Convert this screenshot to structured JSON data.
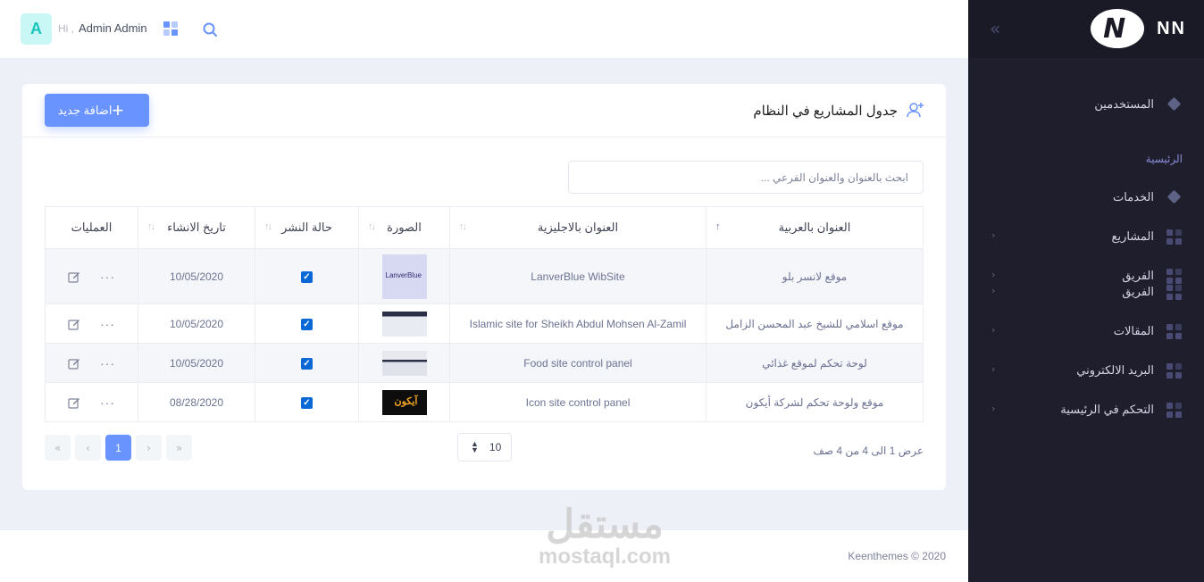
{
  "header": {
    "avatar_letter": "A",
    "greeting": "Hi ,",
    "user_name": "Admin Admin"
  },
  "sidebar": {
    "logo_text": "NN",
    "section_label": "الرئيسية",
    "top_item": "المستخدمين",
    "items": [
      {
        "label": "الخدمات",
        "icon": "diamond-icon",
        "has_arrow": false
      },
      {
        "label": "المشاريع",
        "icon": "grid-icon",
        "has_arrow": true
      },
      {
        "label": "الفريق",
        "icon": "grid-icon",
        "has_arrow": true
      },
      {
        "label": "الفريق",
        "icon": "grid-icon",
        "has_arrow": true
      },
      {
        "label": "المقالات",
        "icon": "grid-icon",
        "has_arrow": true
      },
      {
        "label": "البريد الالكتروني",
        "icon": "grid-icon",
        "has_arrow": true
      },
      {
        "label": "التحكم في الرئيسية",
        "icon": "grid-icon",
        "has_arrow": true
      }
    ]
  },
  "card": {
    "title": "جدول المشاريع في النظام",
    "add_button": "اضافة جديد",
    "search_placeholder": "ابحث بالعنوان والعنوان الفرعي ..."
  },
  "table": {
    "columns": [
      "العنوان بالعربية",
      "العنوان بالاجليزية",
      "الصورة",
      "حالة النشر",
      "تاريخ الانشاء",
      "العمليات"
    ],
    "rows": [
      {
        "title_ar": "موقع لانسر بلو",
        "title_en": "LanverBlue WibSite",
        "image_text": "LanverBlue",
        "published": true,
        "date": "10/05/2020"
      },
      {
        "title_ar": "موقع اسلامي للشيخ عبد المحسن الزامل",
        "title_en": "Islamic site for Sheikh Abdul Mohsen Al-Zamil",
        "image_text": "",
        "published": true,
        "date": "10/05/2020"
      },
      {
        "title_ar": "لوحة تحكم لموقع غذائي",
        "title_en": "Food site control panel",
        "image_text": "",
        "published": true,
        "date": "10/05/2020"
      },
      {
        "title_ar": "موقع ولوحة تحكم لشركة أيكون",
        "title_en": "Icon site control panel",
        "image_text": "آيكون",
        "published": true,
        "date": "08/28/2020"
      }
    ]
  },
  "pagination": {
    "current_page": "1",
    "per_page": "10",
    "info": "عرض 1 الى 4 من 4 صف"
  },
  "footer": {
    "copyright": "Keenthemes ©  2020"
  },
  "watermark": {
    "arabic": "مستقل",
    "latin": "mostaql.com"
  },
  "colors": {
    "primary": "#6993ff",
    "sidebar_bg": "#1e1e2d",
    "checkbox": "#0a67d6"
  }
}
